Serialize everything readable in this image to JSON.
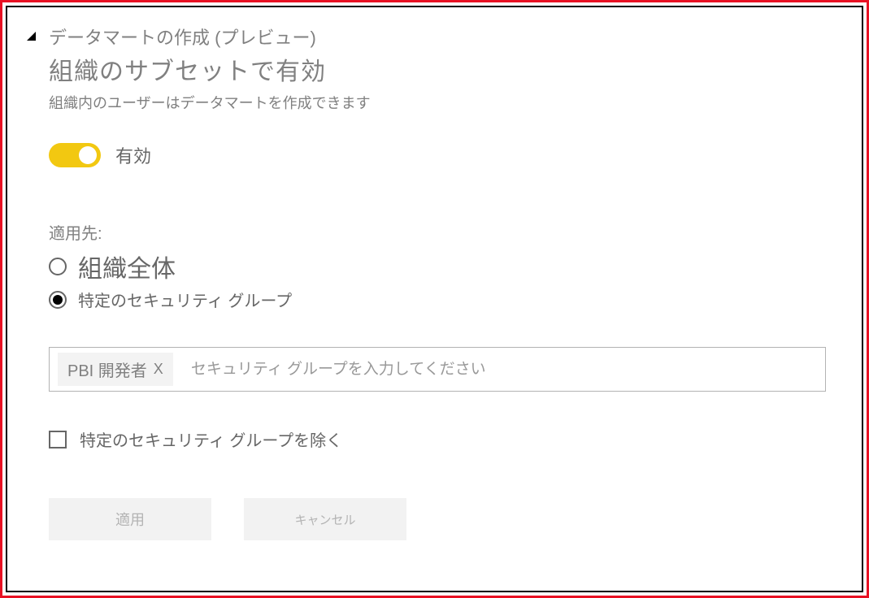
{
  "header": {
    "title": "データマートの作成 (プレビュー)",
    "subtitle": "組織のサブセットで有効",
    "description": "組織内のユーザーはデータマートを作成できます"
  },
  "toggle": {
    "enabled_label": "有効",
    "state": true
  },
  "apply_to": {
    "label": "適用先:",
    "options": {
      "entire_org": "組織全体",
      "specific_groups": "特定のセキュリティ グループ"
    },
    "selected": "specific_groups"
  },
  "security_group_input": {
    "chip_label": "PBI 開発者",
    "chip_remove": "X",
    "placeholder": "セキュリティ グループを入力してください"
  },
  "exclude_checkbox": {
    "label": "特定のセキュリティ グループを除く",
    "checked": false
  },
  "buttons": {
    "apply": "適用",
    "cancel": "キャンセル"
  }
}
